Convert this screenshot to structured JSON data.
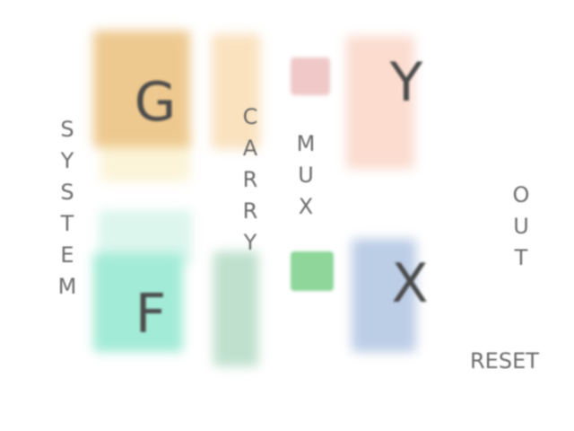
{
  "diagram": {
    "blocks": {
      "g": {
        "letter": "G",
        "color": "#eec98f",
        "fade_color": "#fcf4d8"
      },
      "f": {
        "letter": "F",
        "color": "#a2ebd6",
        "fade_color": "#dcf6ee"
      },
      "y": {
        "letter": "Y",
        "color": "#fbdccf"
      },
      "x": {
        "letter": "X",
        "color": "#bccde6"
      },
      "carry_top": {
        "color": "#fae2bf"
      },
      "carry_bottom": {
        "color": "#bfe0cd"
      },
      "mux_top": {
        "color": "#f0c8c8"
      },
      "mux_bottom": {
        "color": "#8ed69a"
      }
    },
    "labels": {
      "system": "SYSTEM",
      "carry": "CARRY",
      "mux": "MUX",
      "out": "OUT",
      "reset": "RESET"
    }
  }
}
